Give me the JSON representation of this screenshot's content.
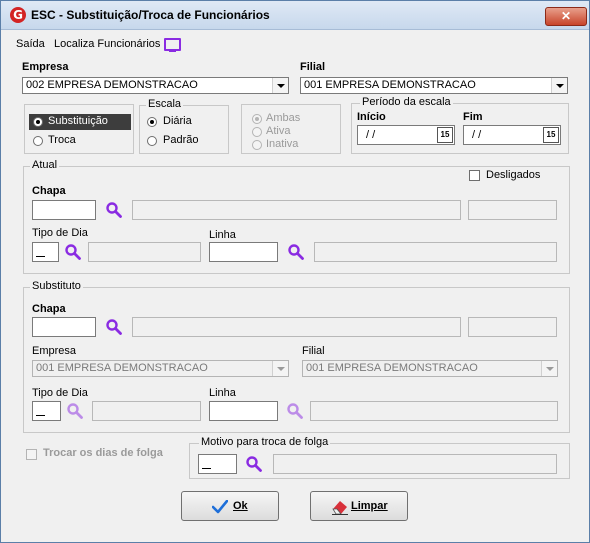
{
  "window": {
    "title": "ESC - Substituição/Troca de Funcionários",
    "close_glyph": "✕",
    "logo_letter": "G"
  },
  "menu": [
    "Saída",
    "Localiza Funcionários"
  ],
  "empresa": {
    "label": "Empresa",
    "value": "002 EMPRESA DEMONSTRACAO"
  },
  "filial": {
    "label": "Filial",
    "value": "001 EMPRESA DEMONSTRACAO"
  },
  "tipo": {
    "options": [
      "Substituição",
      "Troca"
    ],
    "selected": "Substituição"
  },
  "escala": {
    "title": "Escala",
    "options": [
      "Diária",
      "Padrão"
    ],
    "selected": "Diária"
  },
  "ambito": {
    "options": [
      "Ambas",
      "Ativa",
      "Inativa"
    ],
    "selected": "Ambas"
  },
  "periodo": {
    "title": "Período da escala",
    "inicio_label": "Início",
    "inicio_value": "/ /",
    "fim_label": "Fim",
    "fim_value": "/ /",
    "cal_glyph": "15"
  },
  "atual": {
    "title": "Atual",
    "desligados": "Desligados",
    "chapa_label": "Chapa",
    "tipo_dia_label": "Tipo de Dia",
    "linha_label": "Linha"
  },
  "substituto": {
    "title": "Substituto",
    "chapa_label": "Chapa",
    "empresa_label": "Empresa",
    "empresa_value": "001 EMPRESA DEMONSTRACAO",
    "filial_label": "Filial",
    "filial_value": "001 EMPRESA DEMONSTRACAO",
    "tipo_dia_label": "Tipo de Dia",
    "linha_label": "Linha"
  },
  "folga": {
    "trocar_label": "Trocar os dias de folga",
    "motivo_title": "Motivo para troca de folga"
  },
  "buttons": {
    "ok": "Ok",
    "limpar": "Limpar"
  },
  "colors": {
    "accent": "#8a2be2",
    "logo": "#d32424",
    "selected": "#3d3d3d"
  }
}
